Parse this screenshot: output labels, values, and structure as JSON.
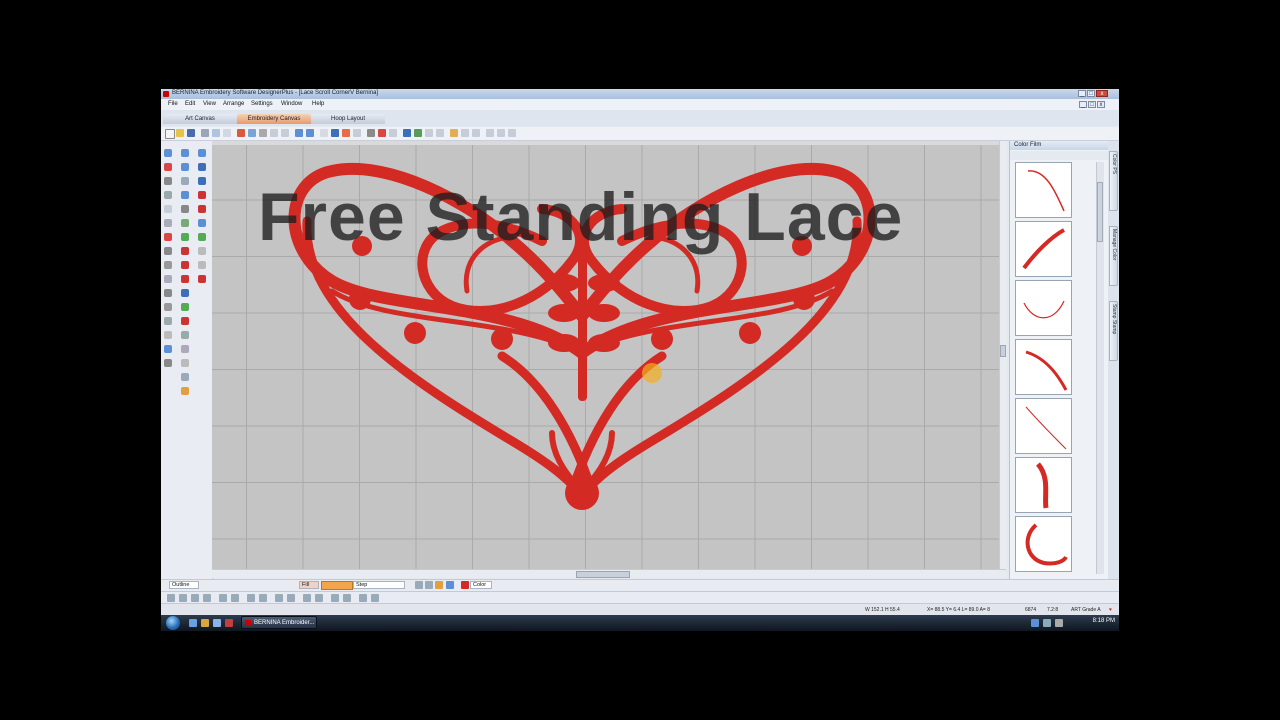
{
  "window": {
    "title": "BERNINA Embroidery Software DesignerPlus - [Lace Scroll CornerV     Bernina]",
    "controls": [
      "_",
      "□",
      "x"
    ]
  },
  "menu": [
    "File",
    "Edit",
    "View",
    "Arrange",
    "Settings",
    "Window",
    "Help"
  ],
  "canvas_tabs": [
    {
      "label": "Art Canvas",
      "active": false
    },
    {
      "label": "Embroidery Canvas",
      "active": true
    },
    {
      "label": "Hoop Layout",
      "active": false
    }
  ],
  "workspace": {
    "overlay_text": "Free Standing Lace",
    "design_color": "#d42a24"
  },
  "color_film": {
    "title": "Color Film",
    "thumbnails": [
      "stitch-object-1",
      "stitch-object-2",
      "stitch-object-3",
      "stitch-object-4",
      "stitch-object-5",
      "stitch-object-6",
      "stitch-object-7"
    ]
  },
  "side_tabs": [
    "Color PS",
    "Manage Color",
    "Stamp Stamp"
  ],
  "bottom": {
    "outline_label": "Outline",
    "fill_label": "Fill",
    "step_label": "Step",
    "color_label": "Color"
  },
  "status": {
    "dimensions": "W 152.1  H 55.4",
    "coords": "X= 88.5  Y= 6.4  L= 89.0  A= 8",
    "stitch_count": "6874",
    "zoom": "7.2:8",
    "grade": "ART Grade A"
  },
  "taskbar": {
    "window_button": "BERNINA Embroider...",
    "clock": "8:18 PM"
  }
}
